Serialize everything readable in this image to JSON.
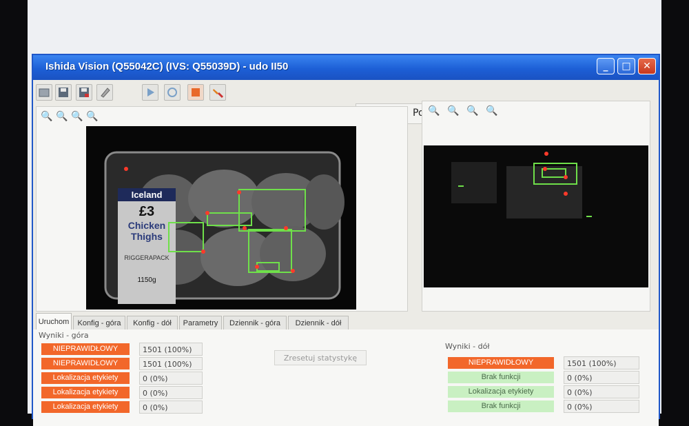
{
  "window": {
    "title": "Ishida Vision (Q55042C) (IVS: Q55039D) - udo II50",
    "min": "_",
    "max": "□",
    "close": "✕"
  },
  "language": {
    "label": "Polski",
    "icon": "globe-icon"
  },
  "toolbar": {
    "icons": [
      "open-icon",
      "save-icon",
      "save-as-icon",
      "edit-icon",
      "play-icon",
      "refresh-icon",
      "stop-icon",
      "tools-icon"
    ]
  },
  "user": {
    "icon": "user-key-icon",
    "level_colors": [
      "#f2e34a",
      "#555555",
      "#555555",
      "#555555"
    ]
  },
  "status": {
    "color": "#2fb52a"
  },
  "left_camera": {
    "zoom_icons": [
      "zoom-out-icon",
      "zoom-fit-icon",
      "zoom-in-icon",
      "zoom-reset-icon"
    ],
    "label": {
      "brand": "Iceland",
      "price": "£3",
      "line1": "Chicken",
      "line2": "Thighs",
      "pack_note": "RIGGERAPACK",
      "weight": "1150g"
    }
  },
  "right_camera": {
    "zoom_icons": [
      "zoom-out-icon",
      "zoom-fit-icon",
      "zoom-in-icon",
      "zoom-reset-icon"
    ]
  },
  "tabs": [
    "Uruchom",
    "Konfig - góra",
    "Konfig - dół",
    "Parametry",
    "Dziennik - góra",
    "Dziennik - dół"
  ],
  "results_top": {
    "title": "Wyniki - góra",
    "rows": [
      {
        "label": "NIEPRAWIDŁOWY",
        "value": "1501 (100%)",
        "status": "bad"
      },
      {
        "label": "NIEPRAWIDŁOWY",
        "value": "1501 (100%)",
        "status": "bad"
      },
      {
        "label": "Lokalizacja etykiety",
        "value": "0 (0%)",
        "status": "bad"
      },
      {
        "label": "Lokalizacja etykiety",
        "value": "0 (0%)",
        "status": "bad"
      },
      {
        "label": "Lokalizacja etykiety",
        "value": "0 (0%)",
        "status": "bad"
      }
    ]
  },
  "reset_button": "Zresetuj statystykę",
  "results_bottom": {
    "title": "Wyniki - dół",
    "rows": [
      {
        "label": "NIEPRAWIDŁOWY",
        "value": "1501 (100%)",
        "status": "bad"
      },
      {
        "label": "Brak funkcji",
        "value": "0 (0%)",
        "status": "ok"
      },
      {
        "label": "Lokalizacja etykiety",
        "value": "0 (0%)",
        "status": "ok"
      },
      {
        "label": "Brak funkcji",
        "value": "0 (0%)",
        "status": "ok"
      }
    ]
  },
  "colors": {
    "bad": "#f2672a",
    "ok": "#c9f0c2",
    "overlay_box": "#6fe04a",
    "overlay_point": "#ff3a2a"
  }
}
